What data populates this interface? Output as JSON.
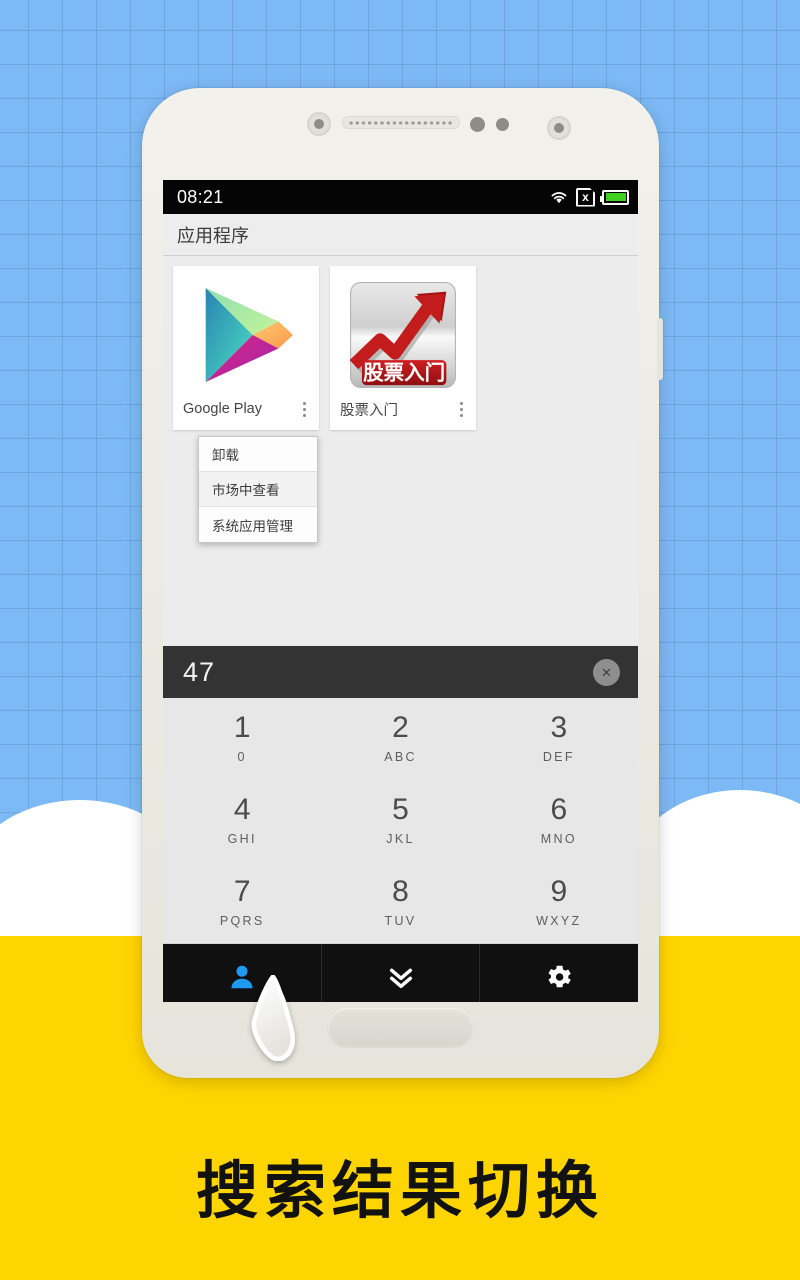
{
  "caption": "搜索结果切换",
  "status_bar": {
    "time": "08:21",
    "wifi_icon": "wifi-icon",
    "sim_icon": "sim-no-service-icon",
    "sim_glyph": "x",
    "battery_icon": "battery-full-icon"
  },
  "action_bar": {
    "title": "应用程序"
  },
  "apps": [
    {
      "label": "Google Play",
      "icon": "google-play-icon",
      "overflow": "overflow-menu-icon"
    },
    {
      "label": "股票入门",
      "icon": "stock-app-icon",
      "icon_banner_text": "股票入门",
      "overflow": "overflow-menu-icon"
    }
  ],
  "context_menu": {
    "items": [
      {
        "label": "卸载",
        "highlight": false
      },
      {
        "label": "市场中查看",
        "highlight": true
      },
      {
        "label": "系统应用管理",
        "highlight": false
      }
    ]
  },
  "dial_input": {
    "value": "47",
    "clear_label": "×",
    "clear_icon": "clear-circle-icon"
  },
  "keypad": {
    "keys": [
      {
        "num": "1",
        "sub": "0"
      },
      {
        "num": "2",
        "sub": "ABC"
      },
      {
        "num": "3",
        "sub": "DEF"
      },
      {
        "num": "4",
        "sub": "GHI"
      },
      {
        "num": "5",
        "sub": "JKL"
      },
      {
        "num": "6",
        "sub": "MNO"
      },
      {
        "num": "7",
        "sub": "PQRS"
      },
      {
        "num": "8",
        "sub": "TUV"
      },
      {
        "num": "9",
        "sub": "WXYZ"
      }
    ]
  },
  "bottom_nav": {
    "items": [
      {
        "icon": "contacts-person-icon",
        "active": true
      },
      {
        "icon": "chevron-double-down-icon",
        "active": false
      },
      {
        "icon": "gear-icon",
        "active": false
      }
    ],
    "active_color": "#1e9bf0",
    "inactive_color": "#ffffff"
  },
  "colors": {
    "background_blue": "#7db9f5",
    "band_yellow": "#ffd500",
    "phone_body": "#eceae2",
    "dial_bar": "#333333",
    "nav_bar": "#101010"
  }
}
